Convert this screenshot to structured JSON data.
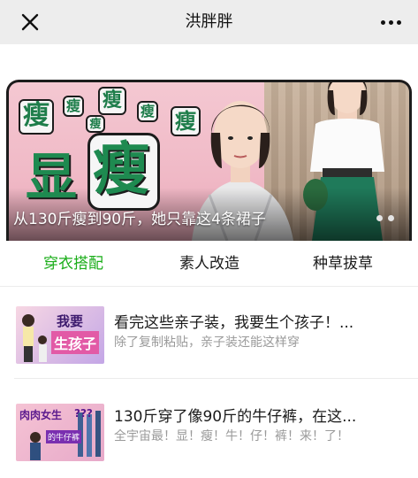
{
  "navbar": {
    "title": "洪胖胖",
    "close_icon": "close-icon",
    "more_icon": "more-dots-icon"
  },
  "banner": {
    "caption": "从130斤瘦到90斤，她只靠这4条裙子",
    "artwork_text": {
      "small_chips": [
        "瘦",
        "瘦",
        "瘦",
        "瘦",
        "瘦",
        "瘦",
        "瘦"
      ],
      "big_left": "显",
      "big_center": "瘦"
    },
    "dots": [
      "inactive",
      "inactive"
    ],
    "colors": {
      "pink": "#f0b9c6",
      "green": "#1e8a50",
      "dot": "#dddddd"
    }
  },
  "tabs": [
    {
      "label": "穿衣搭配",
      "active": true
    },
    {
      "label": "素人改造",
      "active": false
    },
    {
      "label": "种草拔草",
      "active": false
    }
  ],
  "tab_colors": {
    "active": "#1aad19",
    "inactive": "#1a1a1a"
  },
  "articles": [
    {
      "title": "看完这些亲子装，我要生个孩子！...",
      "subtitle": "除了复制粘贴，亲子装还能这样穿",
      "thumb_text": [
        "我要",
        "生孩子"
      ]
    },
    {
      "title": "130斤穿了像90斤的牛仔裤，在这...",
      "subtitle": "全宇宙最！显！瘦！牛！仔！裤！来！了！",
      "thumb_text": [
        "肉肉女生",
        "???",
        "的牛仔裤"
      ]
    }
  ]
}
